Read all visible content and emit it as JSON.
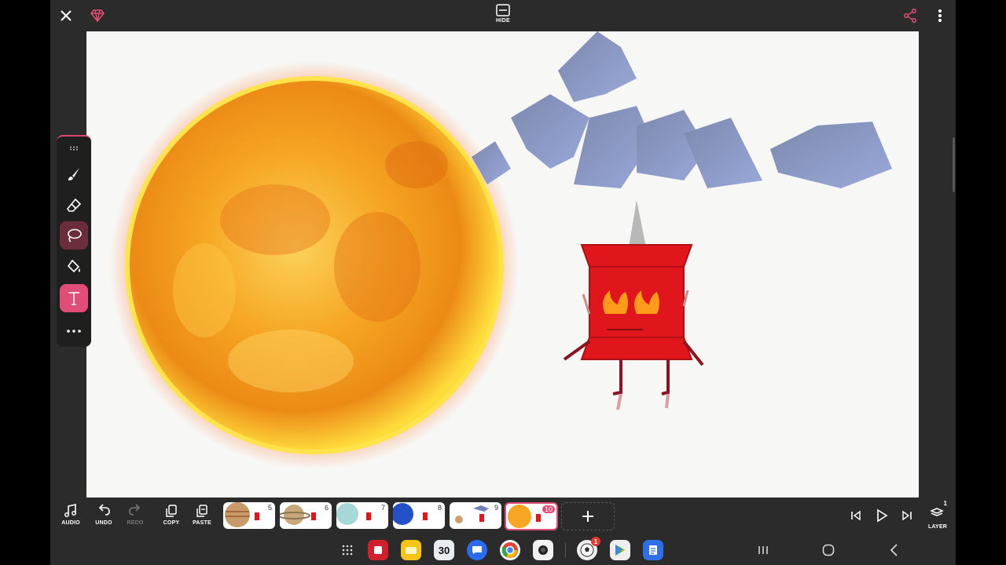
{
  "topbar": {
    "hide_label": "HIDE"
  },
  "bottombar": {
    "audio_label": "AUDIO",
    "undo_label": "UNDO",
    "redo_label": "REDO",
    "copy_label": "COPY",
    "paste_label": "PASTE",
    "layer_label": "LAYER",
    "layer_count": "1",
    "frames": [
      "5",
      "6",
      "7",
      "8",
      "9",
      "10"
    ],
    "active_frame": "10"
  },
  "navbar": {
    "calendar_day": "30",
    "notification_badge": "1"
  },
  "colors": {
    "accent": "#e24d78",
    "toolbar_bg": "#2b2b2b"
  }
}
